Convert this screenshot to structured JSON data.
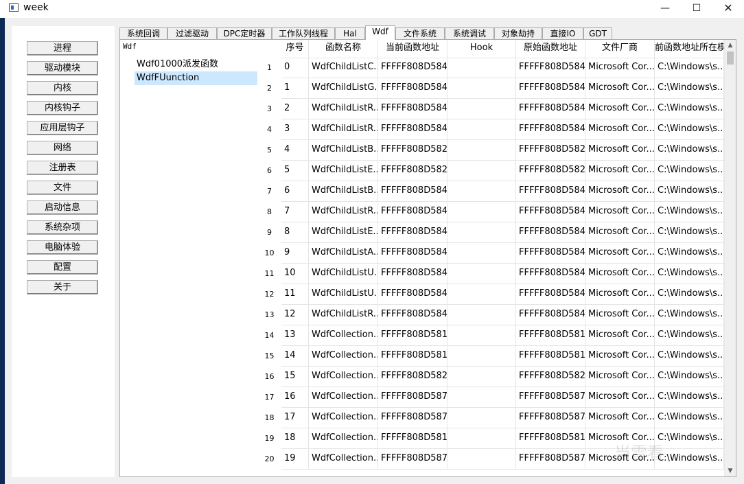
{
  "window": {
    "title": "week",
    "minimize": "—",
    "maximize": "☐",
    "close": "✕"
  },
  "sidebar": {
    "items": [
      "进程",
      "驱动模块",
      "内核",
      "内核钩子",
      "应用层钩子",
      "网络",
      "注册表",
      "文件",
      "启动信息",
      "系统杂项",
      "电脑体验",
      "配置",
      "关于"
    ]
  },
  "tabs": {
    "active": "Wdf",
    "items": [
      "系统回调",
      "过滤驱动",
      "DPC定时器",
      "工作队列线程",
      "Hal",
      "Wdf",
      "文件系统",
      "系统调试",
      "对象劫持",
      "直接IO",
      "GDT"
    ]
  },
  "tree": {
    "root": "Wdf",
    "items": [
      "Wdf01000派发函数",
      "WdfFUunction"
    ],
    "selected": 1
  },
  "table": {
    "headers": [
      "序号",
      "函数名称",
      "当前函数地址",
      "Hook",
      "原始函数地址",
      "文件厂商",
      "前函数地址所在模"
    ],
    "rows": [
      [
        "0",
        "WdfChildListC...",
        "FFFFF808D584...",
        "",
        "FFFFF808D584...",
        "Microsoft Cor...",
        "C:\\Windows\\s..."
      ],
      [
        "1",
        "WdfChildListG...",
        "FFFFF808D584...",
        "",
        "FFFFF808D584...",
        "Microsoft Cor...",
        "C:\\Windows\\s..."
      ],
      [
        "2",
        "WdfChildListR...",
        "FFFFF808D584...",
        "",
        "FFFFF808D584...",
        "Microsoft Cor...",
        "C:\\Windows\\s..."
      ],
      [
        "3",
        "WdfChildListR...",
        "FFFFF808D584...",
        "",
        "FFFFF808D584...",
        "Microsoft Cor...",
        "C:\\Windows\\s..."
      ],
      [
        "4",
        "WdfChildListB...",
        "FFFFF808D582...",
        "",
        "FFFFF808D582...",
        "Microsoft Cor...",
        "C:\\Windows\\s..."
      ],
      [
        "5",
        "WdfChildListE...",
        "FFFFF808D582...",
        "",
        "FFFFF808D582...",
        "Microsoft Cor...",
        "C:\\Windows\\s..."
      ],
      [
        "6",
        "WdfChildListB...",
        "FFFFF808D584...",
        "",
        "FFFFF808D584...",
        "Microsoft Cor...",
        "C:\\Windows\\s..."
      ],
      [
        "7",
        "WdfChildListR...",
        "FFFFF808D584...",
        "",
        "FFFFF808D584...",
        "Microsoft Cor...",
        "C:\\Windows\\s..."
      ],
      [
        "8",
        "WdfChildListE...",
        "FFFFF808D584...",
        "",
        "FFFFF808D584...",
        "Microsoft Cor...",
        "C:\\Windows\\s..."
      ],
      [
        "9",
        "WdfChildListA...",
        "FFFFF808D584...",
        "",
        "FFFFF808D584...",
        "Microsoft Cor...",
        "C:\\Windows\\s..."
      ],
      [
        "10",
        "WdfChildListU...",
        "FFFFF808D584...",
        "",
        "FFFFF808D584...",
        "Microsoft Cor...",
        "C:\\Windows\\s..."
      ],
      [
        "11",
        "WdfChildListU...",
        "FFFFF808D584...",
        "",
        "FFFFF808D584...",
        "Microsoft Cor...",
        "C:\\Windows\\s..."
      ],
      [
        "12",
        "WdfChildListR...",
        "FFFFF808D584...",
        "",
        "FFFFF808D584...",
        "Microsoft Cor...",
        "C:\\Windows\\s..."
      ],
      [
        "13",
        "WdfCollection...",
        "FFFFF808D581...",
        "",
        "FFFFF808D581...",
        "Microsoft Cor...",
        "C:\\Windows\\s..."
      ],
      [
        "14",
        "WdfCollection...",
        "FFFFF808D581...",
        "",
        "FFFFF808D581...",
        "Microsoft Cor...",
        "C:\\Windows\\s..."
      ],
      [
        "15",
        "WdfCollection...",
        "FFFFF808D582...",
        "",
        "FFFFF808D582...",
        "Microsoft Cor...",
        "C:\\Windows\\s..."
      ],
      [
        "16",
        "WdfCollection...",
        "FFFFF808D587...",
        "",
        "FFFFF808D587...",
        "Microsoft Cor...",
        "C:\\Windows\\s..."
      ],
      [
        "17",
        "WdfCollection...",
        "FFFFF808D587...",
        "",
        "FFFFF808D587...",
        "Microsoft Cor...",
        "C:\\Windows\\s..."
      ],
      [
        "18",
        "WdfCollection...",
        "FFFFF808D581...",
        "",
        "FFFFF808D581...",
        "Microsoft Cor...",
        "C:\\Windows\\s..."
      ],
      [
        "19",
        "WdfCollection...",
        "FFFFF808D587...",
        "",
        "FFFFF808D587...",
        "Microsoft Cor...",
        "C:\\Windows\\s..."
      ]
    ],
    "row_numbers": [
      "1",
      "2",
      "3",
      "4",
      "5",
      "6",
      "7",
      "8",
      "9",
      "10",
      "11",
      "12",
      "13",
      "14",
      "15",
      "16",
      "17",
      "18",
      "19",
      "20"
    ]
  },
  "scrollbar": {
    "up_icon": "▲",
    "down_icon": "▼"
  },
  "watermark_text": "当雪看"
}
